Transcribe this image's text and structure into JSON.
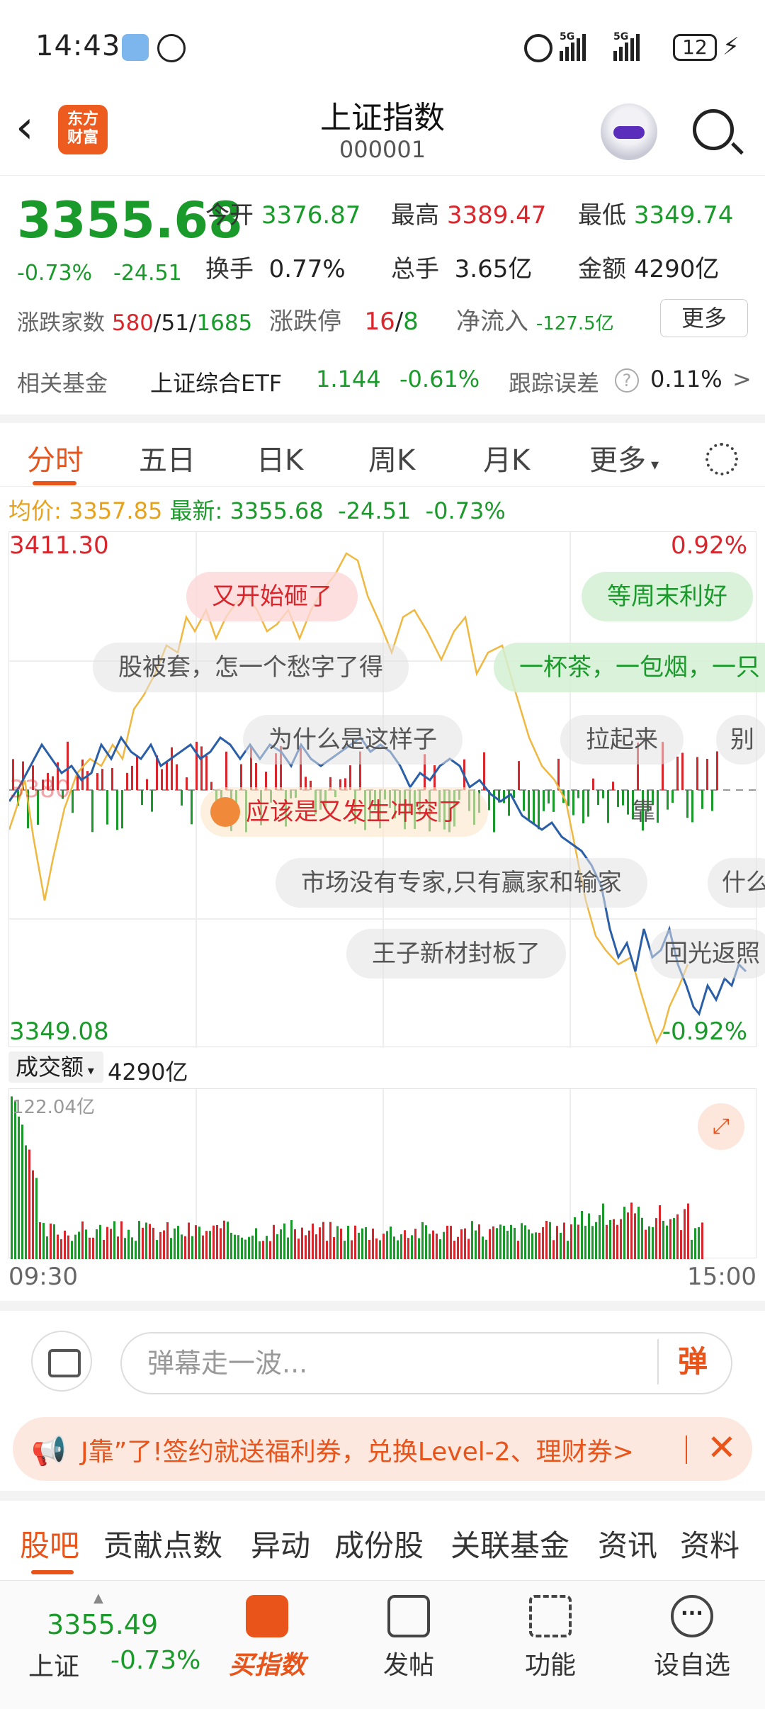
{
  "status_bar": {
    "time": "14:43",
    "battery": "12",
    "network_1": "5G",
    "network_2": "5G"
  },
  "header": {
    "title": "上证指数",
    "code": "000001",
    "logo_text": "东方财富"
  },
  "quote": {
    "price": "3355.68",
    "change_pct": "-0.73%",
    "change_val": "-24.51",
    "open_label": "今开",
    "open": "3376.87",
    "high_label": "最高",
    "high": "3389.47",
    "low_label": "最低",
    "low": "3349.74",
    "turnover_label": "换手",
    "turnover": "0.77%",
    "volume_label": "总手",
    "volume": "3.65亿",
    "amount_label": "金额",
    "amount": "4290亿",
    "breadth_label": "涨跌家数",
    "breadth_up": "580",
    "breadth_flat": "51",
    "breadth_down": "1685",
    "limit_label": "涨跌停",
    "limit_up": "16",
    "limit_down": "8",
    "inflow_label": "净流入",
    "inflow": "-127.5亿",
    "more_label": "更多"
  },
  "fund": {
    "label": "相关基金",
    "name": "上证综合ETF",
    "price": "1.144",
    "pct": "-0.61%",
    "track_label": "跟踪误差",
    "track_val": "0.11%",
    "arrow": ">"
  },
  "tabs": {
    "t1": "分时",
    "t2": "五日",
    "t3": "日K",
    "t4": "周K",
    "t5": "月K",
    "t6": "更多"
  },
  "avg_line": {
    "avg_label": "均价:",
    "avg": "3357.85",
    "latest_label": "最新:",
    "latest": "3355.68",
    "chg": "-24.51",
    "pct": "-0.73%"
  },
  "chart_labels": {
    "y_top": "3411.30",
    "y_bottom": "3349.08",
    "pct_top": "0.92%",
    "pct_bottom": "-0.92%",
    "ref_partial": "3380"
  },
  "danmu": {
    "d1": "又开始砸了",
    "d2": "等周末利好",
    "d3": "股被套，怎一个愁字了得",
    "d4": "一杯茶，一包烟，一只",
    "d5": "为什么是这样子",
    "d6": "拉起来",
    "d7": "别",
    "d8": "应该是又发生冲突了",
    "d9": "靠",
    "d10": "市场没有专家,只有赢家和输家",
    "d11": "什么",
    "d12": "王子新材封板了",
    "d13": "回光返照"
  },
  "volume": {
    "selector": "成交额",
    "amount": "4290亿",
    "max_label": "122.04亿",
    "time_start": "09:30",
    "time_end": "15:00"
  },
  "comment": {
    "placeholder": "弹幕走一波...",
    "dan_label": "弹"
  },
  "banner": {
    "text": "J靠”了!签约就送福利券，兑换Level-2、理财券>"
  },
  "bottom_tabs": {
    "b1": "股吧",
    "b2": "贡献点数",
    "b3": "异动",
    "b4": "成份股",
    "b5": "关联基金",
    "b6": "资讯",
    "b7": "资料"
  },
  "nav": {
    "price": "3355.49",
    "name": "上证",
    "pct": "-0.73%",
    "buy": "买指数",
    "post": "发帖",
    "func": "功能",
    "watch": "设自选"
  },
  "colors": {
    "up": "#d9262c",
    "down": "#1a9a2a",
    "accent": "#e8541a",
    "price_line": "#2a5fa8",
    "avg_line": "#f0b840"
  },
  "chart_data": {
    "type": "line",
    "title": "",
    "xlabel": "",
    "ylabel": "",
    "x_range": [
      "09:30",
      "15:00"
    ],
    "ylim": [
      3349.08,
      3411.3
    ],
    "pct_range": [
      -0.92,
      0.92
    ],
    "series": []
  }
}
